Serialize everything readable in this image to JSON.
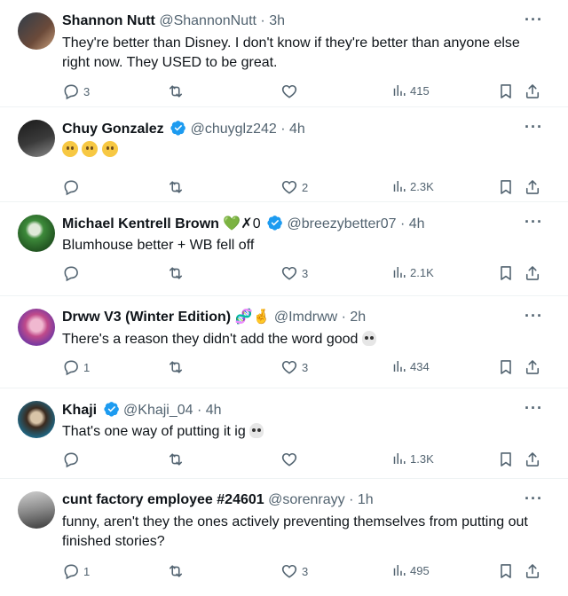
{
  "colors": {
    "verified": "#1d9bf0",
    "text": "#0f1419",
    "secondary": "#536471",
    "divider": "#eff3f4"
  },
  "tweets": [
    {
      "name": "Shannon Nutt",
      "handle": "@ShannonNutt · 3h",
      "text_lines": [
        "They're better than Disney. I don't know if they're better than anyone else",
        "right now. They USED to be great."
      ],
      "replies": "3",
      "retweets": "",
      "likes": "",
      "views": "415"
    },
    {
      "name": "Chuy Gonzalez",
      "handle": "@chuyglz242 · 4h",
      "emoji_count": 3,
      "replies": "",
      "retweets": "",
      "likes": "2",
      "views": "2.3K"
    },
    {
      "name": "Michael Kentrell Brown",
      "name_suffix": "💚✗0",
      "handle": "@breezybetter07 · 4h",
      "text": "Blumhouse better + WB fell off",
      "replies": "",
      "retweets": "",
      "likes": "3",
      "views": "2.1K"
    },
    {
      "name": "Drww V3 (Winter Edition)",
      "name_suffix": "🧬🤞",
      "handle": "@Imdrww · 2h",
      "text": "There's a reason they didn't add the word good",
      "replies": "1",
      "retweets": "",
      "likes": "3",
      "views": "434"
    },
    {
      "name": "Khaji",
      "handle": "@Khaji_04 · 4h",
      "text": "That's one way of putting it ig",
      "replies": "",
      "retweets": "",
      "likes": "",
      "views": "1.3K"
    },
    {
      "name": "cunt factory employee #24601",
      "handle": "@sorenrayy · 1h",
      "text_lines": [
        "funny, aren't they the ones actively preventing themselves from putting out",
        "finished stories?"
      ],
      "replies": "1",
      "retweets": "",
      "likes": "3",
      "views": "495"
    }
  ]
}
